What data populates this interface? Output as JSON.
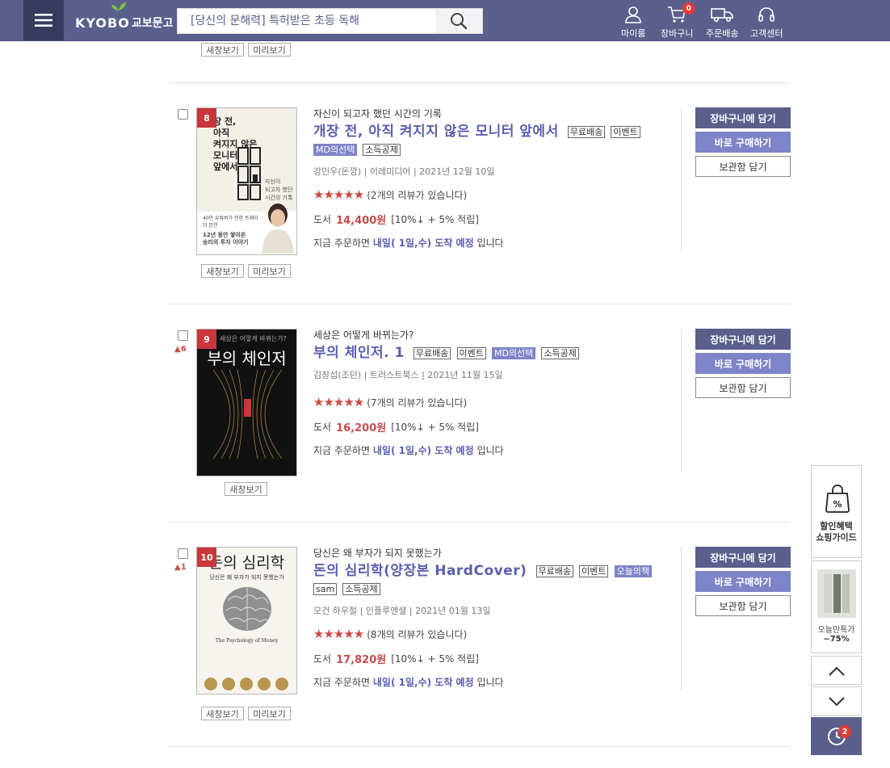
{
  "header": {
    "logo_en": "KYOBO",
    "logo_ko": "교보문고",
    "search_placeholder": "[당신의 문해력] 특허받은 초등 독해",
    "nav": [
      {
        "label": "마이룸",
        "icon": "user-icon"
      },
      {
        "label": "장바구니",
        "icon": "cart-icon",
        "count": "0"
      },
      {
        "label": "주문배송",
        "icon": "truck-icon"
      },
      {
        "label": "고객센터",
        "icon": "headset-icon"
      }
    ]
  },
  "top_buttons": {
    "new_window": "새창보기",
    "preview": "미리보기"
  },
  "items": [
    {
      "rank": "8",
      "rank_change": "",
      "subtitle": "자신이 되고자 했던 시간의 기록",
      "title": "개장 전, 아직 켜지지 않은 모니터 앞에서",
      "tags": [
        "무료배송",
        "이벤트",
        "MD의선택",
        "소득공제"
      ],
      "meta": "강민우(돈깡) | 이레미디어 | 2021년 12월 10일",
      "stars": "★★★★★",
      "reviews": "(2개의 리뷰가 있습니다)",
      "price_label": "도서",
      "price": "14,400원",
      "discount": "[10%↓ + 5% 적립]",
      "delivery_pre": "지금 주문하면",
      "delivery_em": "내일( 1일,수) 도착 예정",
      "delivery_post": "입니다",
      "cover_text": [
        "장 전,",
        "아직",
        "켜지지 않은",
        "모니터",
        "앞에서"
      ],
      "cover_footer": [
        "40만 유튜버가 전한 트레이더 본연",
        "12년 동안 쌓아온",
        "승리의 투자 이야기"
      ],
      "cover_side": [
        "자신이",
        "되고자 했던",
        "시간의 기록"
      ],
      "buttons": {
        "new_window": "새창보기",
        "preview": "미리보기"
      }
    },
    {
      "rank": "9",
      "rank_change": "▲6",
      "subtitle": "세상은 어떻게 바뀌는가?",
      "title": "부의 체인저. 1",
      "tags": [
        "무료배송",
        "이벤트",
        "MD의선택",
        "소득공제"
      ],
      "meta": "김장섭(조던) | 트러스트북스 | 2021년 11월 15일",
      "stars": "★★★★★",
      "reviews": "(7개의 리뷰가 있습니다)",
      "price_label": "도서",
      "price": "16,200원",
      "discount": "[10%↓ + 5% 적립]",
      "delivery_pre": "지금 주문하면",
      "delivery_em": "내일( 1일,수) 도착 예정",
      "delivery_post": "입니다",
      "cover_text": [
        "세상은 어떻게 바뀌는가?",
        "부의 체인저"
      ],
      "buttons": {
        "new_window": "새창보기"
      }
    },
    {
      "rank": "10",
      "rank_change": "▲1",
      "subtitle": "당신은 왜 부자가 되지 못했는가",
      "title": "돈의 심리학(양장본 HardCover)",
      "tags": [
        "무료배송",
        "이벤트",
        "오늘의책",
        "sam",
        "소득공제"
      ],
      "meta": "모건 하우절 | 인플루엔셜 | 2021년 01월 13일",
      "stars": "★★★★★",
      "reviews": "(8개의 리뷰가 있습니다)",
      "price_label": "도서",
      "price": "17,820원",
      "discount": "[10%↓ + 5% 적립]",
      "delivery_pre": "지금 주문하면",
      "delivery_em": "내일( 1일,수) 도착 예정",
      "delivery_post": "입니다",
      "cover_text": [
        "돈의 심리학",
        "당신은 왜 부자가 되지 못했는가",
        "The Psychology of Money"
      ],
      "buttons": {
        "new_window": "새창보기",
        "preview": "미리보기"
      }
    }
  ],
  "actions": {
    "cart": "장바구니에 담기",
    "buy": "바로 구매하기",
    "save": "보관함 담기"
  },
  "float": {
    "discount_guide": [
      "할인혜택",
      "쇼핑가이드"
    ],
    "today_deal": "오늘만특가",
    "today_rate": "~75%",
    "recent_count": "2"
  }
}
